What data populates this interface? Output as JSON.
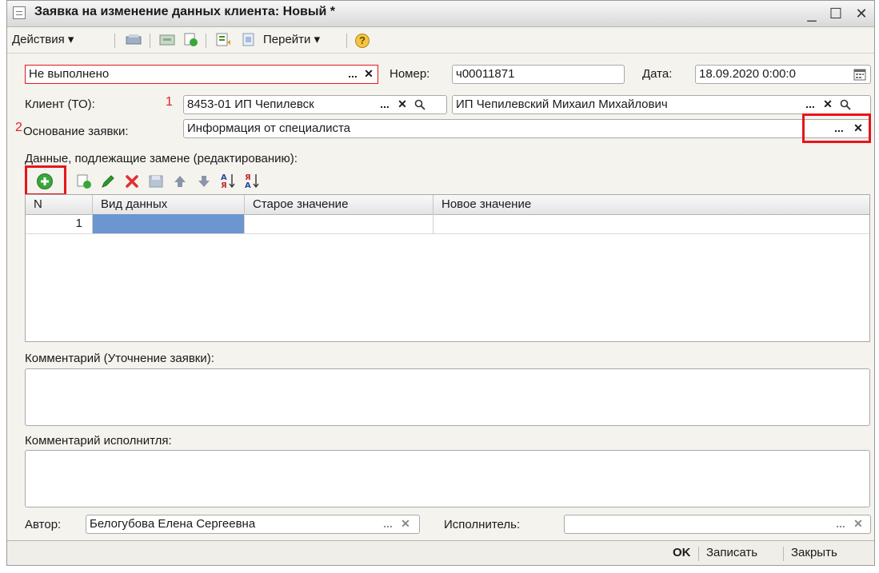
{
  "window": {
    "title": "Заявка на изменение данных клиента: Новый *",
    "minimize_glyph": "_",
    "maximize_glyph": "☐",
    "close_glyph": "✕"
  },
  "toolbar": {
    "actions_label": "Действия",
    "goto_label": "Перейти",
    "dropdown_glyph": "▾",
    "help_glyph": "?"
  },
  "header": {
    "status_value": "Не выполнено",
    "number_label": "Номер:",
    "number_value": "ч00011871",
    "date_label": "Дата:",
    "date_value": "18.09.2020 0:00:0"
  },
  "client": {
    "label": "Клиент (ТО):",
    "marker": "1",
    "code_value": "8453-01 ИП Чепилевск",
    "name_value": "ИП Чепилевский Михаил Михайлович"
  },
  "basis": {
    "marker": "2",
    "label": "Основание заявки:",
    "value": "Информация от специалиста"
  },
  "field_buttons": {
    "select": "...",
    "clear": "✕",
    "search": "🔍"
  },
  "table": {
    "section_label": "Данные, подлежащие замене (редактированию):",
    "columns": [
      "N",
      "Вид данных",
      "Старое значение",
      "Новое значение"
    ],
    "rows": [
      {
        "n": "1",
        "data_type": "",
        "old_value": "",
        "new_value": ""
      }
    ]
  },
  "comment": {
    "label": "Комментарий (Уточнение заявки):",
    "value": ""
  },
  "executor_comment": {
    "label": "Комментарий исполнитля:",
    "value": ""
  },
  "footer": {
    "author_label": "Автор:",
    "author_value": "Белогубова Елена Сергеевна",
    "executor_label": "Исполнитель:",
    "executor_value": ""
  },
  "buttons": {
    "ok": "OK",
    "save": "Записать",
    "close": "Закрыть"
  },
  "colors": {
    "highlight": "#e8141b",
    "selected_cell": "#6b96cf",
    "add_icon": "#3aa63a",
    "delete_icon": "#e03030",
    "edit_icon": "#2e9b2e",
    "arrow_icon": "#8a95a8"
  }
}
